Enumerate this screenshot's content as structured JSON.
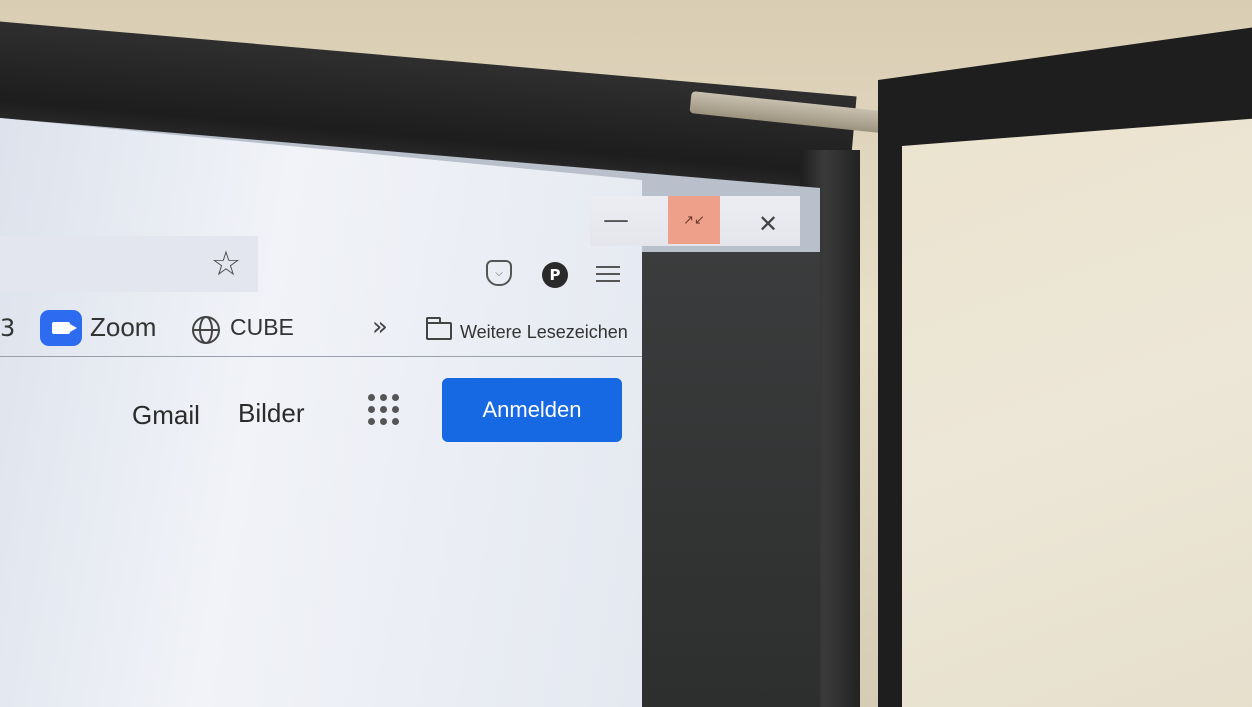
{
  "window_controls": {
    "minimize_glyph": "—",
    "restore_glyph": "↗↙",
    "close_glyph": "✕"
  },
  "toolbar": {
    "bookmark_star_icon": "star-icon",
    "pocket_icon": "pocket-icon",
    "profile_initial": "P",
    "menu_icon": "hamburger-menu-icon"
  },
  "bookmarks": {
    "truncated_text": "3",
    "items": [
      {
        "label": "Zoom",
        "icon": "zoom-icon"
      },
      {
        "label": "CUBE",
        "icon": "globe-icon"
      }
    ],
    "overflow_glyph": "»",
    "other_bookmarks_label": "Weitere Lesezeichen"
  },
  "header": {
    "gmail_label": "Gmail",
    "images_label": "Bilder",
    "apps_icon": "apps-grid-icon",
    "signin_label": "Anmelden"
  },
  "colors": {
    "signin_button": "#1668e3",
    "zoom_brand": "#2d6cf0",
    "restore_highlight": "#eea08b"
  }
}
